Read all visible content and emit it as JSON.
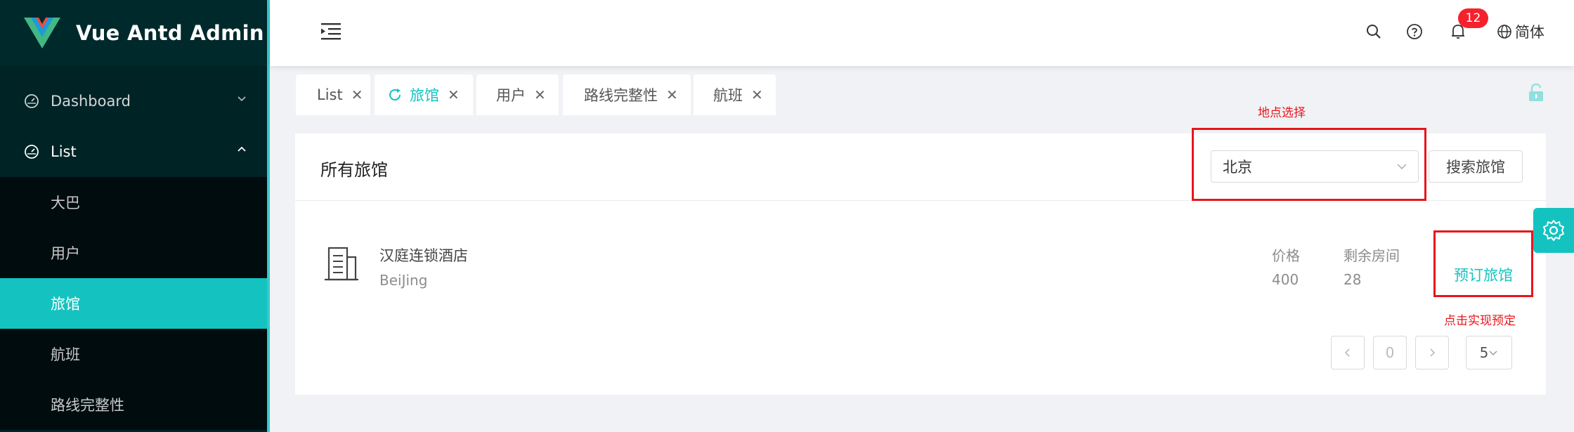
{
  "app": {
    "title": "Vue Antd Admin"
  },
  "sidebar": {
    "items": [
      {
        "label": "Dashboard",
        "icon": "dashboard-icon",
        "expanded": false
      },
      {
        "label": "List",
        "icon": "dashboard-icon",
        "expanded": true
      }
    ],
    "submenu": [
      "大巴",
      "用户",
      "旅馆",
      "航班",
      "路线完整性"
    ],
    "active_submenu": "旅馆"
  },
  "header": {
    "notification_count": "12",
    "language": "简体"
  },
  "tabs": [
    {
      "label": "List",
      "active": false
    },
    {
      "label": "旅馆",
      "active": true
    },
    {
      "label": "用户",
      "active": false
    },
    {
      "label": "路线完整性",
      "active": false
    },
    {
      "label": "航班",
      "active": false
    }
  ],
  "card": {
    "title": "所有旅馆",
    "city_select": "北京",
    "search_button": "搜索旅馆"
  },
  "hotels": [
    {
      "name": "汉庭连锁酒店",
      "city": "BeiJing",
      "price_label": "价格",
      "price": "400",
      "rooms_label": "剩余房间",
      "rooms": "28",
      "book_label": "预订旅馆"
    }
  ],
  "pagination": {
    "current": "0",
    "page_size": "5"
  },
  "annotations": {
    "location_note": "地点选择",
    "booking_note": "点击实现预定"
  },
  "colors": {
    "accent": "#14c3c0",
    "sidebar": "#002326",
    "annotation": "#e8151b"
  }
}
